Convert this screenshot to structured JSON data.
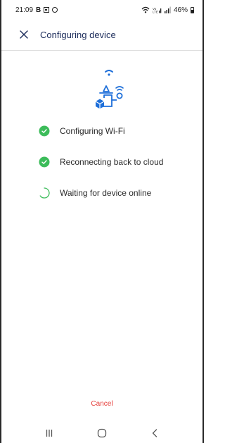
{
  "status_bar": {
    "time": "21:09",
    "badge_b": "B",
    "battery": "46%",
    "signal_label": "Vo LTE"
  },
  "header": {
    "title": "Configuring device",
    "close_icon": "close-icon"
  },
  "illustration": {
    "icon": "wifi-device-config-illustration",
    "accent": "#1e6fd9"
  },
  "steps": [
    {
      "label": "Configuring Wi-Fi",
      "status": "done"
    },
    {
      "label": "Reconnecting back to cloud",
      "status": "done"
    },
    {
      "label": "Waiting for device online",
      "status": "in-progress"
    }
  ],
  "colors": {
    "success": "#3cbc5a",
    "danger": "#e53935",
    "title": "#1b2b5a"
  },
  "footer": {
    "cancel_label": "Cancel"
  },
  "nav": {
    "recent_icon": "recent-apps-icon",
    "home_icon": "home-icon",
    "back_icon": "back-icon"
  }
}
